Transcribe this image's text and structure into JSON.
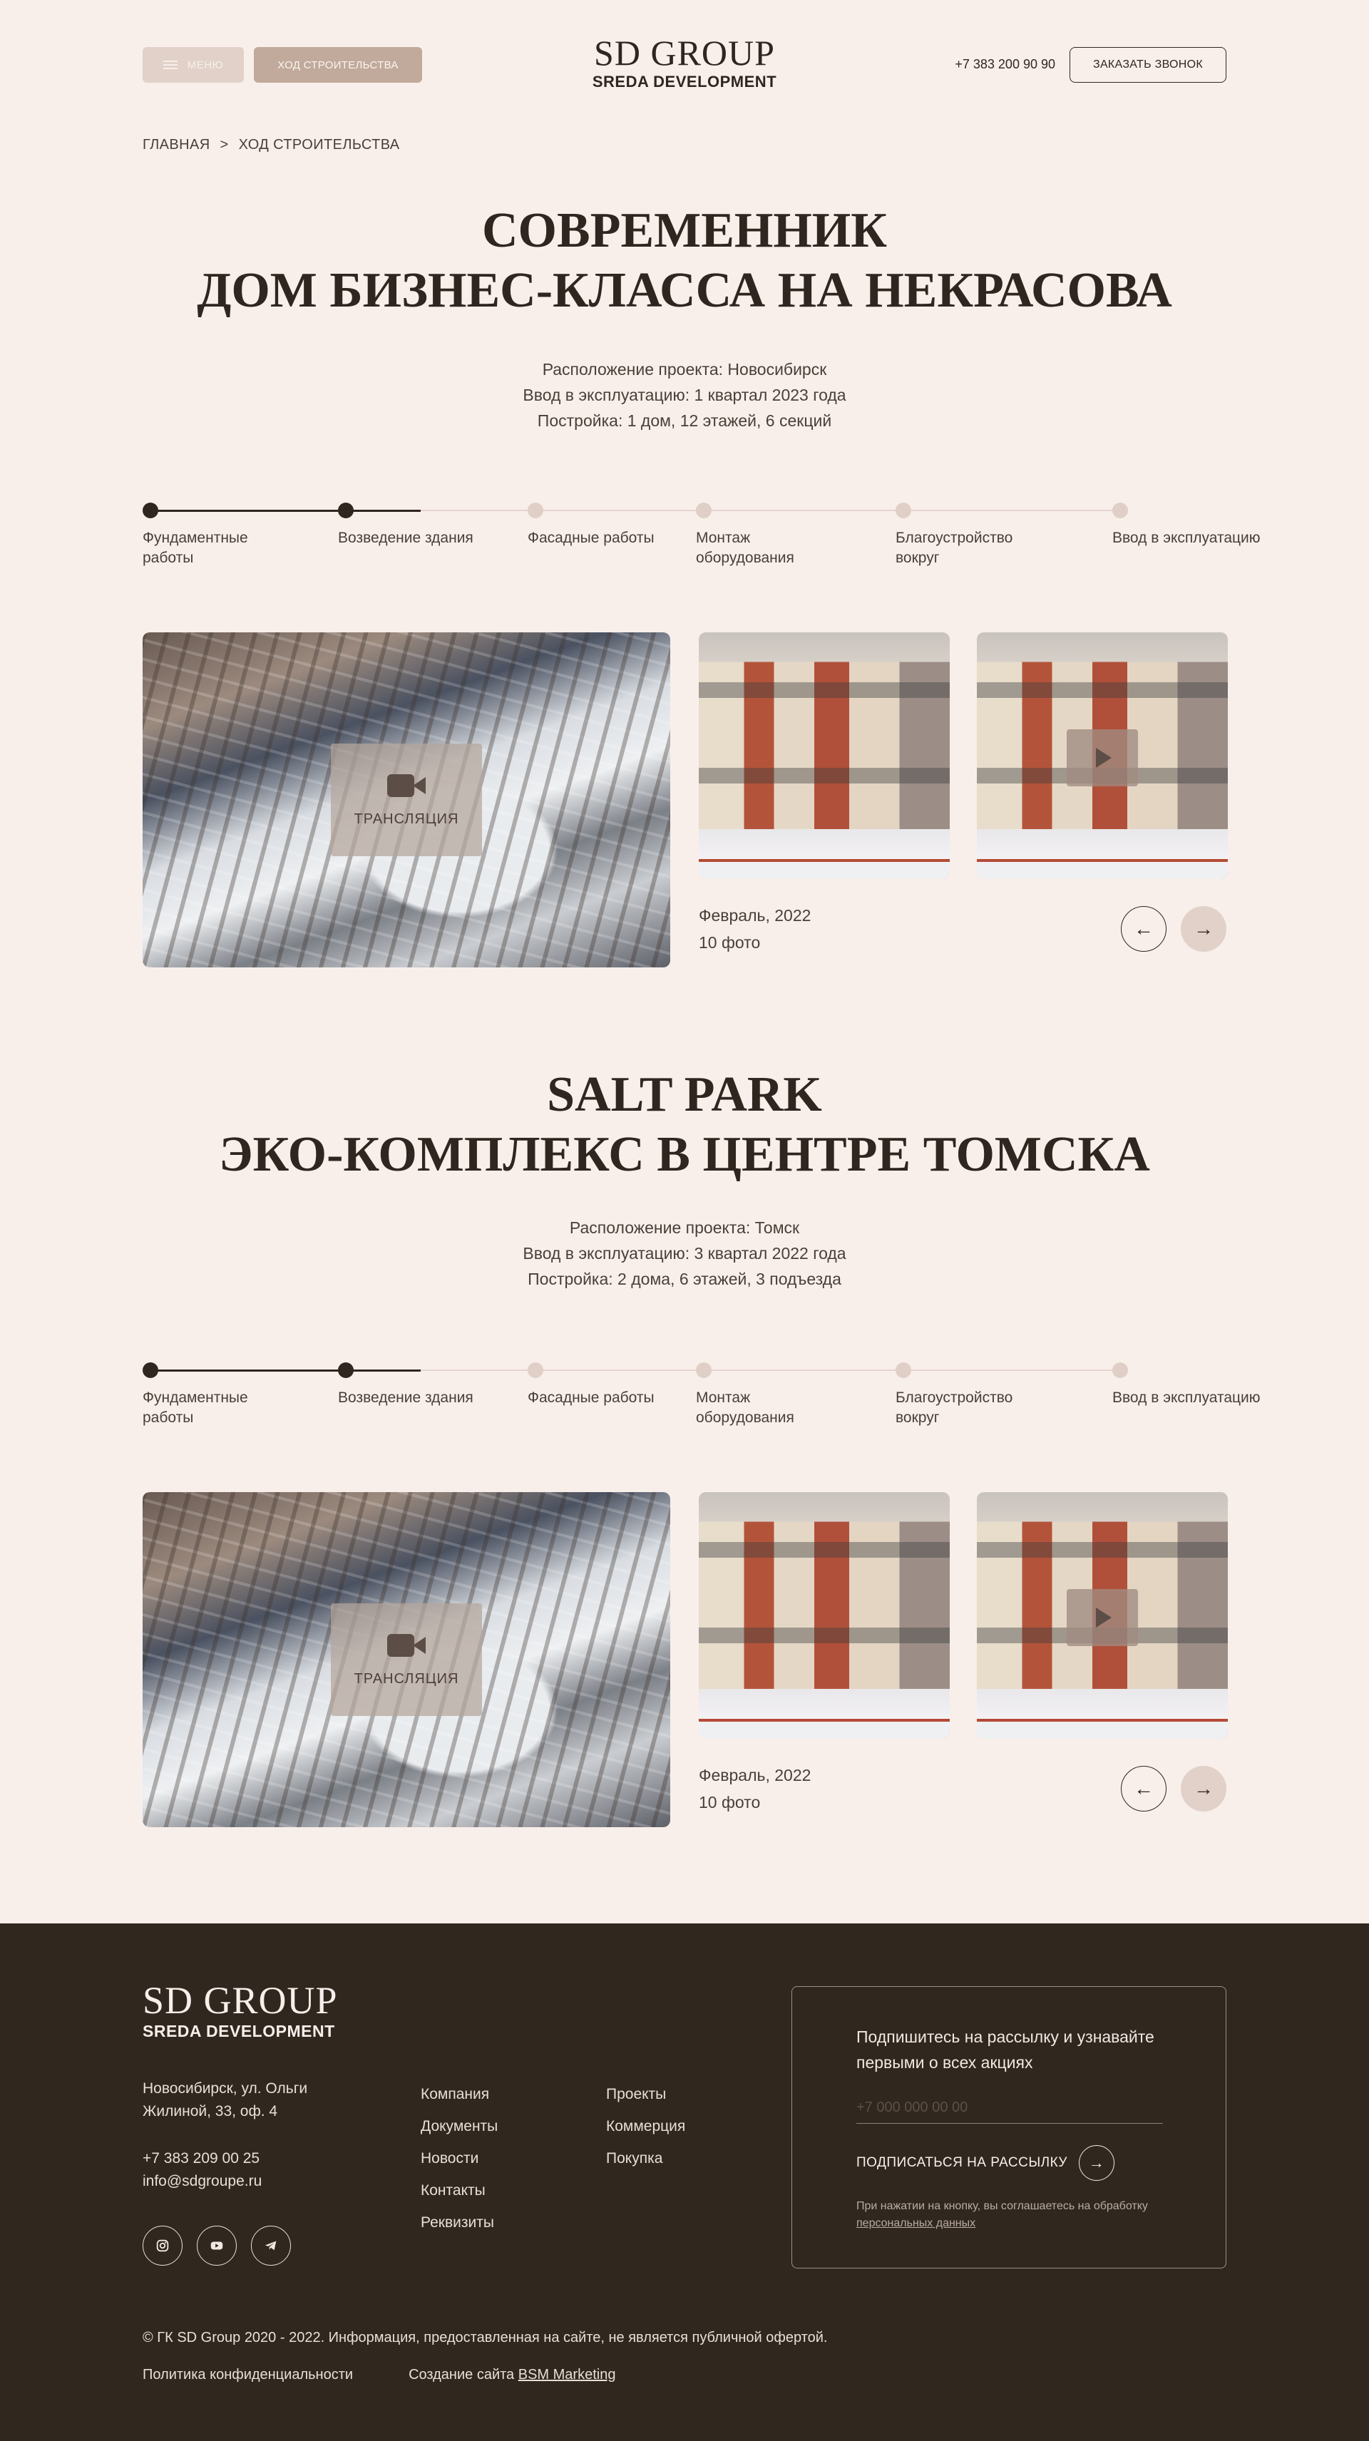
{
  "header": {
    "menu_label": "МЕНЮ",
    "progress_label": "ХОД СТРОИТЕЛЬСТВА",
    "logo_main": "SD GROUP",
    "logo_sub": "SREDA DEVELOPMENT",
    "phone": "+7 383 200 90 90",
    "callback_label": "ЗАКАЗАТЬ ЗВОНОК"
  },
  "breadcrumb": {
    "home": "ГЛАВНАЯ",
    "separator": ">",
    "current": "ХОД СТРОИТЕЛЬСТВА"
  },
  "projects": [
    {
      "title_line1": "СОВРЕМЕННИК",
      "title_line2": "ДОМ БИЗНЕС-КЛАССА НА НЕКРАСОВА",
      "info": [
        "Расположение проекта: Новосибирск",
        "Ввод в эксплуатацию: 1 квартал 2023 года",
        "Постройка: 1 дом, 12 этажей, 6 секций"
      ],
      "stages": [
        {
          "label": "Фундаментные работы",
          "done": true
        },
        {
          "label": "Возведение здания",
          "done": true
        },
        {
          "label": "Фасадные работы",
          "done": false
        },
        {
          "label": "Монтаж оборудования",
          "done": false
        },
        {
          "label": "Благоустройство вокруг",
          "done": false
        },
        {
          "label": "Ввод в эксплуатацию",
          "done": false
        }
      ],
      "stream_label": "ТРАНСЛЯЦИЯ",
      "photo_date": "Февраль, 2022",
      "photo_count": "10 фото"
    },
    {
      "title_line1": "SALT PARK",
      "title_line2": "ЭКО-КОМПЛЕКС В ЦЕНТРЕ ТОМСКА",
      "info": [
        "Расположение проекта: Томск",
        "Ввод в эксплуатацию: 3 квартал 2022 года",
        "Постройка: 2 дома, 6 этажей, 3 подъезда"
      ],
      "stages": [
        {
          "label": "Фундаментные работы",
          "done": true
        },
        {
          "label": "Возведение здания",
          "done": true
        },
        {
          "label": "Фасадные работы",
          "done": false
        },
        {
          "label": "Монтаж оборудования",
          "done": false
        },
        {
          "label": "Благоустройство вокруг",
          "done": false
        },
        {
          "label": "Ввод в эксплуатацию",
          "done": false
        }
      ],
      "stream_label": "ТРАНСЛЯЦИЯ",
      "photo_date": "Февраль, 2022",
      "photo_count": "10 фото"
    }
  ],
  "arrows": {
    "prev": "←",
    "next": "→"
  },
  "footer": {
    "logo_main": "SD GROUP",
    "logo_sub": "SREDA DEVELOPMENT",
    "address": "Новосибирск, ул. Ольги Жилиной, 33, оф. 4",
    "phone": "+7 383 209 00 25",
    "email": "info@sdgroupe.ru",
    "nav_col1": [
      "Компания",
      "Документы",
      "Новости",
      "Контакты",
      "Реквизиты"
    ],
    "nav_col2": [
      "Проекты",
      "Коммерция",
      "Покупка"
    ],
    "subscribe_text": "Подпишитесь на рассылку и узнавайте первыми о всех акциях",
    "subscribe_placeholder": "+7 000 000 00 00",
    "subscribe_button": "ПОДПИСАТЬСЯ НА РАССЫЛКУ",
    "subscribe_arrow": "→",
    "note_prefix": "При нажатии на кнопку, вы соглашаетесь на обработку",
    "note_link": "персональных данных",
    "copyright": "© ГК SD Group 2020 - 2022. Информация, предоставленная на сайте, не является публичной офертой.",
    "privacy": "Политика конфиденциальности",
    "made_by_prefix": "Создание сайта",
    "made_by_link": "BSM Marketing"
  },
  "colors": {
    "background": "#f8efeb",
    "text": "#2f261f",
    "accent": "#c1aa9b",
    "footer_bg": "#30271f"
  },
  "icons": [
    "burger-icon",
    "video-camera-icon",
    "play-icon",
    "instagram-icon",
    "youtube-icon",
    "telegram-icon",
    "arrow-left-icon",
    "arrow-right-icon"
  ]
}
